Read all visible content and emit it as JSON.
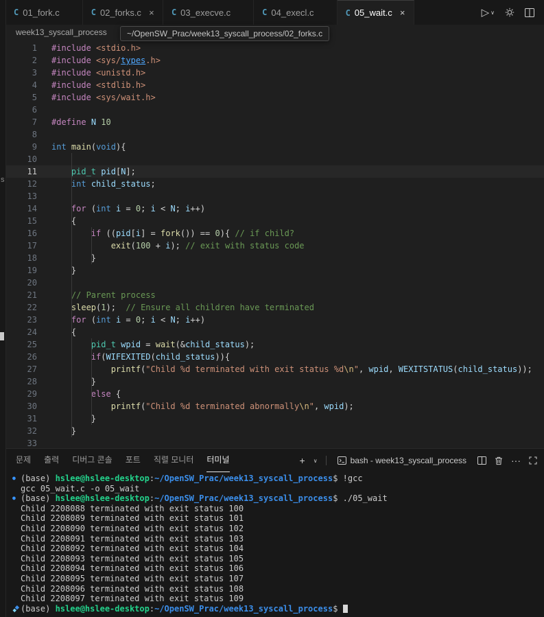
{
  "editor_tabs": [
    {
      "label": "01_fork.c",
      "active": false,
      "close": false
    },
    {
      "label": "02_forks.c",
      "active": false,
      "close": true
    },
    {
      "label": "03_execve.c",
      "active": false,
      "close": false
    },
    {
      "label": "04_execl.c",
      "active": false,
      "close": false
    },
    {
      "label": "05_wait.c",
      "active": true,
      "close": true
    }
  ],
  "breadcrumb": {
    "text": "week13_syscall_process"
  },
  "tooltip": {
    "text": "~/OpenSW_Prac/week13_syscall_process/02_forks.c"
  },
  "icons": {
    "close": "×",
    "run": "▷",
    "chevron_down": "∨",
    "new_terminal": "+",
    "more": "···",
    "prompt_decoration": "●"
  },
  "artifacts": {
    "strip_letter": "s"
  },
  "colors": {
    "tokens": {
      "k": "#C586C0",
      "t": "#569CD6",
      "ut": "#4EC9B0",
      "fn": "#DCDCAA",
      "v": "#9CDCFE",
      "n": "#B5CEA8",
      "s": "#CE9178",
      "e": "#D7BA7D",
      "c": "#6A9955",
      "p": "#D4D4D4",
      "lnk": "#4FA8FF"
    },
    "terminal": {
      "w": "#CCCCCC",
      "g": "#23D18B",
      "b": "#3B8EEA",
      "deco": "#3794FF"
    }
  },
  "editor": {
    "current_line": 11,
    "lines": [
      {
        "n": 1,
        "tk": [
          [
            "k",
            "#include"
          ],
          [
            "p",
            " "
          ],
          [
            "s",
            "<stdio.h>"
          ]
        ]
      },
      {
        "n": 2,
        "tk": [
          [
            "k",
            "#include"
          ],
          [
            "p",
            " "
          ],
          [
            "s",
            "<sys/"
          ],
          [
            "lnk",
            "types"
          ],
          [
            "s",
            ".h>"
          ]
        ]
      },
      {
        "n": 3,
        "tk": [
          [
            "k",
            "#include"
          ],
          [
            "p",
            " "
          ],
          [
            "s",
            "<unistd.h>"
          ]
        ]
      },
      {
        "n": 4,
        "tk": [
          [
            "k",
            "#include"
          ],
          [
            "p",
            " "
          ],
          [
            "s",
            "<stdlib.h>"
          ]
        ]
      },
      {
        "n": 5,
        "tk": [
          [
            "k",
            "#include"
          ],
          [
            "p",
            " "
          ],
          [
            "s",
            "<sys/wait.h>"
          ]
        ]
      },
      {
        "n": 6,
        "tk": []
      },
      {
        "n": 7,
        "tk": [
          [
            "k",
            "#define"
          ],
          [
            "p",
            " "
          ],
          [
            "v",
            "N"
          ],
          [
            "p",
            " "
          ],
          [
            "n",
            "10"
          ]
        ]
      },
      {
        "n": 8,
        "tk": []
      },
      {
        "n": 9,
        "tk": [
          [
            "t",
            "int"
          ],
          [
            "p",
            " "
          ],
          [
            "fn",
            "main"
          ],
          [
            "p",
            "("
          ],
          [
            "t",
            "void"
          ],
          [
            "p",
            "){"
          ]
        ]
      },
      {
        "n": 10,
        "tk": []
      },
      {
        "n": 11,
        "tk": [
          [
            "p",
            "    "
          ],
          [
            "ut",
            "pid_t"
          ],
          [
            "p",
            " "
          ],
          [
            "v",
            "pid"
          ],
          [
            "p",
            "["
          ],
          [
            "v",
            "N"
          ],
          [
            "p",
            "];"
          ]
        ]
      },
      {
        "n": 12,
        "tk": [
          [
            "p",
            "    "
          ],
          [
            "t",
            "int"
          ],
          [
            "p",
            " "
          ],
          [
            "v",
            "child_status"
          ],
          [
            "p",
            ";"
          ]
        ]
      },
      {
        "n": 13,
        "tk": []
      },
      {
        "n": 14,
        "tk": [
          [
            "p",
            "    "
          ],
          [
            "k",
            "for"
          ],
          [
            "p",
            " ("
          ],
          [
            "t",
            "int"
          ],
          [
            "p",
            " "
          ],
          [
            "v",
            "i"
          ],
          [
            "p",
            " = "
          ],
          [
            "n",
            "0"
          ],
          [
            "p",
            "; "
          ],
          [
            "v",
            "i"
          ],
          [
            "p",
            " < "
          ],
          [
            "v",
            "N"
          ],
          [
            "p",
            "; "
          ],
          [
            "v",
            "i"
          ],
          [
            "p",
            "++)"
          ]
        ]
      },
      {
        "n": 15,
        "tk": [
          [
            "p",
            "    {"
          ]
        ]
      },
      {
        "n": 16,
        "tk": [
          [
            "p",
            "        "
          ],
          [
            "k",
            "if"
          ],
          [
            "p",
            " (("
          ],
          [
            "v",
            "pid"
          ],
          [
            "p",
            "["
          ],
          [
            "v",
            "i"
          ],
          [
            "p",
            "] = "
          ],
          [
            "fn",
            "fork"
          ],
          [
            "p",
            "()) == "
          ],
          [
            "n",
            "0"
          ],
          [
            "p",
            "){ "
          ],
          [
            "c",
            "// if child?"
          ]
        ]
      },
      {
        "n": 17,
        "tk": [
          [
            "p",
            "            "
          ],
          [
            "fn",
            "exit"
          ],
          [
            "p",
            "("
          ],
          [
            "n",
            "100"
          ],
          [
            "p",
            " + "
          ],
          [
            "v",
            "i"
          ],
          [
            "p",
            "); "
          ],
          [
            "c",
            "// exit with status code"
          ]
        ]
      },
      {
        "n": 18,
        "tk": [
          [
            "p",
            "        }"
          ]
        ]
      },
      {
        "n": 19,
        "tk": [
          [
            "p",
            "    }"
          ]
        ]
      },
      {
        "n": 20,
        "tk": []
      },
      {
        "n": 21,
        "tk": [
          [
            "p",
            "    "
          ],
          [
            "c",
            "// Parent process"
          ]
        ]
      },
      {
        "n": 22,
        "tk": [
          [
            "p",
            "    "
          ],
          [
            "fn",
            "sleep"
          ],
          [
            "p",
            "("
          ],
          [
            "n",
            "1"
          ],
          [
            "p",
            ");  "
          ],
          [
            "c",
            "// Ensure all children have terminated"
          ]
        ]
      },
      {
        "n": 23,
        "tk": [
          [
            "p",
            "    "
          ],
          [
            "k",
            "for"
          ],
          [
            "p",
            " ("
          ],
          [
            "t",
            "int"
          ],
          [
            "p",
            " "
          ],
          [
            "v",
            "i"
          ],
          [
            "p",
            " = "
          ],
          [
            "n",
            "0"
          ],
          [
            "p",
            "; "
          ],
          [
            "v",
            "i"
          ],
          [
            "p",
            " < "
          ],
          [
            "v",
            "N"
          ],
          [
            "p",
            "; "
          ],
          [
            "v",
            "i"
          ],
          [
            "p",
            "++)"
          ]
        ]
      },
      {
        "n": 24,
        "tk": [
          [
            "p",
            "    {"
          ]
        ]
      },
      {
        "n": 25,
        "tk": [
          [
            "p",
            "        "
          ],
          [
            "ut",
            "pid_t"
          ],
          [
            "p",
            " "
          ],
          [
            "v",
            "wpid"
          ],
          [
            "p",
            " = "
          ],
          [
            "fn",
            "wait"
          ],
          [
            "p",
            "(&"
          ],
          [
            "v",
            "child_status"
          ],
          [
            "p",
            ");"
          ]
        ]
      },
      {
        "n": 26,
        "tk": [
          [
            "p",
            "        "
          ],
          [
            "k",
            "if"
          ],
          [
            "p",
            "("
          ],
          [
            "v",
            "WIFEXITED"
          ],
          [
            "p",
            "("
          ],
          [
            "v",
            "child_status"
          ],
          [
            "p",
            ")){"
          ]
        ]
      },
      {
        "n": 27,
        "tk": [
          [
            "p",
            "            "
          ],
          [
            "fn",
            "printf"
          ],
          [
            "p",
            "("
          ],
          [
            "s",
            "\"Child %d terminated with exit status %d"
          ],
          [
            "e",
            "\\n"
          ],
          [
            "s",
            "\""
          ],
          [
            "p",
            ", "
          ],
          [
            "v",
            "wpid"
          ],
          [
            "p",
            ", "
          ],
          [
            "v",
            "WEXITSTATUS"
          ],
          [
            "p",
            "("
          ],
          [
            "v",
            "child_status"
          ],
          [
            "p",
            "));"
          ]
        ]
      },
      {
        "n": 28,
        "tk": [
          [
            "p",
            "        }"
          ]
        ]
      },
      {
        "n": 29,
        "tk": [
          [
            "p",
            "        "
          ],
          [
            "k",
            "else"
          ],
          [
            "p",
            " {"
          ]
        ]
      },
      {
        "n": 30,
        "tk": [
          [
            "p",
            "            "
          ],
          [
            "fn",
            "printf"
          ],
          [
            "p",
            "("
          ],
          [
            "s",
            "\"Child %d terminated abnormally"
          ],
          [
            "e",
            "\\n"
          ],
          [
            "s",
            "\""
          ],
          [
            "p",
            ", "
          ],
          [
            "v",
            "wpid"
          ],
          [
            "p",
            ");"
          ]
        ]
      },
      {
        "n": 31,
        "tk": [
          [
            "p",
            "        }"
          ]
        ]
      },
      {
        "n": 32,
        "tk": [
          [
            "p",
            "    }"
          ]
        ]
      },
      {
        "n": 33,
        "tk": []
      }
    ]
  },
  "panel": {
    "tabs": [
      {
        "name": "problems",
        "label": "문제",
        "active": false
      },
      {
        "name": "output",
        "label": "출력",
        "active": false
      },
      {
        "name": "debug-console",
        "label": "디버그 콘솔",
        "active": false
      },
      {
        "name": "ports",
        "label": "포트",
        "active": false
      },
      {
        "name": "serial-monitor",
        "label": "직렬 모니터",
        "active": false
      },
      {
        "name": "terminal",
        "label": "터미널",
        "active": true
      }
    ],
    "shell_label": "bash - week13_syscall_process"
  },
  "terminal": {
    "lines": [
      {
        "deco": "circle",
        "tk": [
          [
            "w",
            "(base) "
          ],
          [
            "g",
            "hslee@hslee-desktop"
          ],
          [
            "w",
            ":"
          ],
          [
            "b",
            "~/OpenSW_Prac/week13_syscall_process"
          ],
          [
            "w",
            "$ "
          ],
          [
            "w",
            "!gcc"
          ]
        ]
      },
      {
        "tk": [
          [
            "w",
            "gcc 05_wait.c -o 05_wait"
          ]
        ]
      },
      {
        "deco": "circle",
        "tk": [
          [
            "w",
            "(base) "
          ],
          [
            "g",
            "hslee@hslee-desktop"
          ],
          [
            "w",
            ":"
          ],
          [
            "b",
            "~/OpenSW_Prac/week13_syscall_process"
          ],
          [
            "w",
            "$ "
          ],
          [
            "w",
            "./05_wait"
          ]
        ]
      },
      {
        "tk": [
          [
            "w",
            "Child 2208088 terminated with exit status 100"
          ]
        ]
      },
      {
        "tk": [
          [
            "w",
            "Child 2208089 terminated with exit status 101"
          ]
        ]
      },
      {
        "tk": [
          [
            "w",
            "Child 2208090 terminated with exit status 102"
          ]
        ]
      },
      {
        "tk": [
          [
            "w",
            "Child 2208091 terminated with exit status 103"
          ]
        ]
      },
      {
        "tk": [
          [
            "w",
            "Child 2208092 terminated with exit status 104"
          ]
        ]
      },
      {
        "tk": [
          [
            "w",
            "Child 2208093 terminated with exit status 105"
          ]
        ]
      },
      {
        "tk": [
          [
            "w",
            "Child 2208094 terminated with exit status 106"
          ]
        ]
      },
      {
        "tk": [
          [
            "w",
            "Child 2208095 terminated with exit status 107"
          ]
        ]
      },
      {
        "tk": [
          [
            "w",
            "Child 2208096 terminated with exit status 108"
          ]
        ]
      },
      {
        "tk": [
          [
            "w",
            "Child 2208097 terminated with exit status 109"
          ]
        ]
      },
      {
        "deco": "sparkle",
        "cursor": true,
        "tk": [
          [
            "w",
            "(base) "
          ],
          [
            "g",
            "hslee@hslee-desktop"
          ],
          [
            "w",
            ":"
          ],
          [
            "b",
            "~/OpenSW_Prac/week13_syscall_process"
          ],
          [
            "w",
            "$ "
          ]
        ]
      }
    ]
  }
}
